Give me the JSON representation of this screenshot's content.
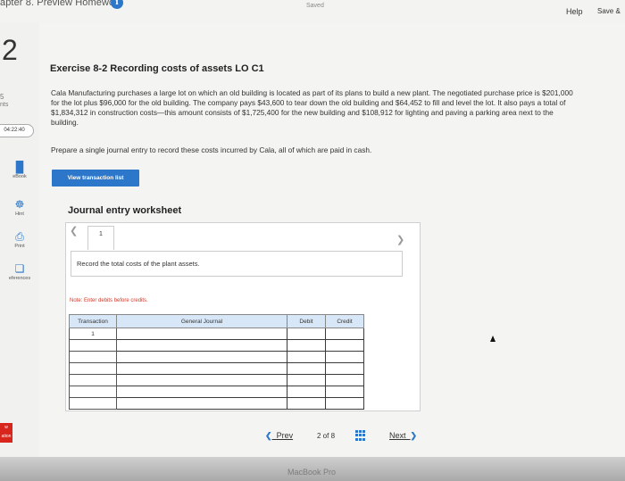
{
  "topbar": {
    "title": "apter 8. Preview Homework",
    "info_icon": "info-icon",
    "status": "Saved",
    "help_label": "Help",
    "save_exit_label": "Save &"
  },
  "check_label": "Ch",
  "sidebar": {
    "question_number": "2",
    "points_value": "5",
    "points_label": "nts",
    "timer": "04:22:40",
    "tools": [
      {
        "icon": "book-icon",
        "label": "eBook"
      },
      {
        "icon": "hint-icon",
        "label": "Hint"
      },
      {
        "icon": "print-icon",
        "label": "Print"
      },
      {
        "icon": "references-icon",
        "label": "eferences"
      }
    ],
    "badge_top": "w",
    "badge_bottom": "ation"
  },
  "exercise": {
    "title": "Exercise 8-2 Recording costs of assets LO C1",
    "problem": "Cala Manufacturing purchases a large lot on which an old building is located as part of its plans to build a new plant. The negotiated purchase price is $201,000 for the lot plus $96,000 for the old building. The company pays $43,600 to tear down the old building and $64,452 to fill and level the lot. It also pays a total of $1,834,312 in construction costs—this amount consists of $1,725,400 for the new building and $108,912 for lighting and paving a parking area next to the building.",
    "prompt": "Prepare a single journal entry to record these costs incurred by Cala, all of which are paid in cash."
  },
  "view_transaction_label": "View transaction list",
  "worksheet": {
    "title": "Journal entry worksheet",
    "tab_label": "1",
    "instruction": "Record the total costs of the plant assets.",
    "note": "Note: Enter debits before credits.",
    "columns": [
      "Transaction",
      "General Journal",
      "Debit",
      "Credit"
    ],
    "first_transaction": "1"
  },
  "pager": {
    "prev_label": "Prev",
    "page_indicator": "2 of 8",
    "next_label": "Next"
  },
  "device_label": "MacBook Pro"
}
